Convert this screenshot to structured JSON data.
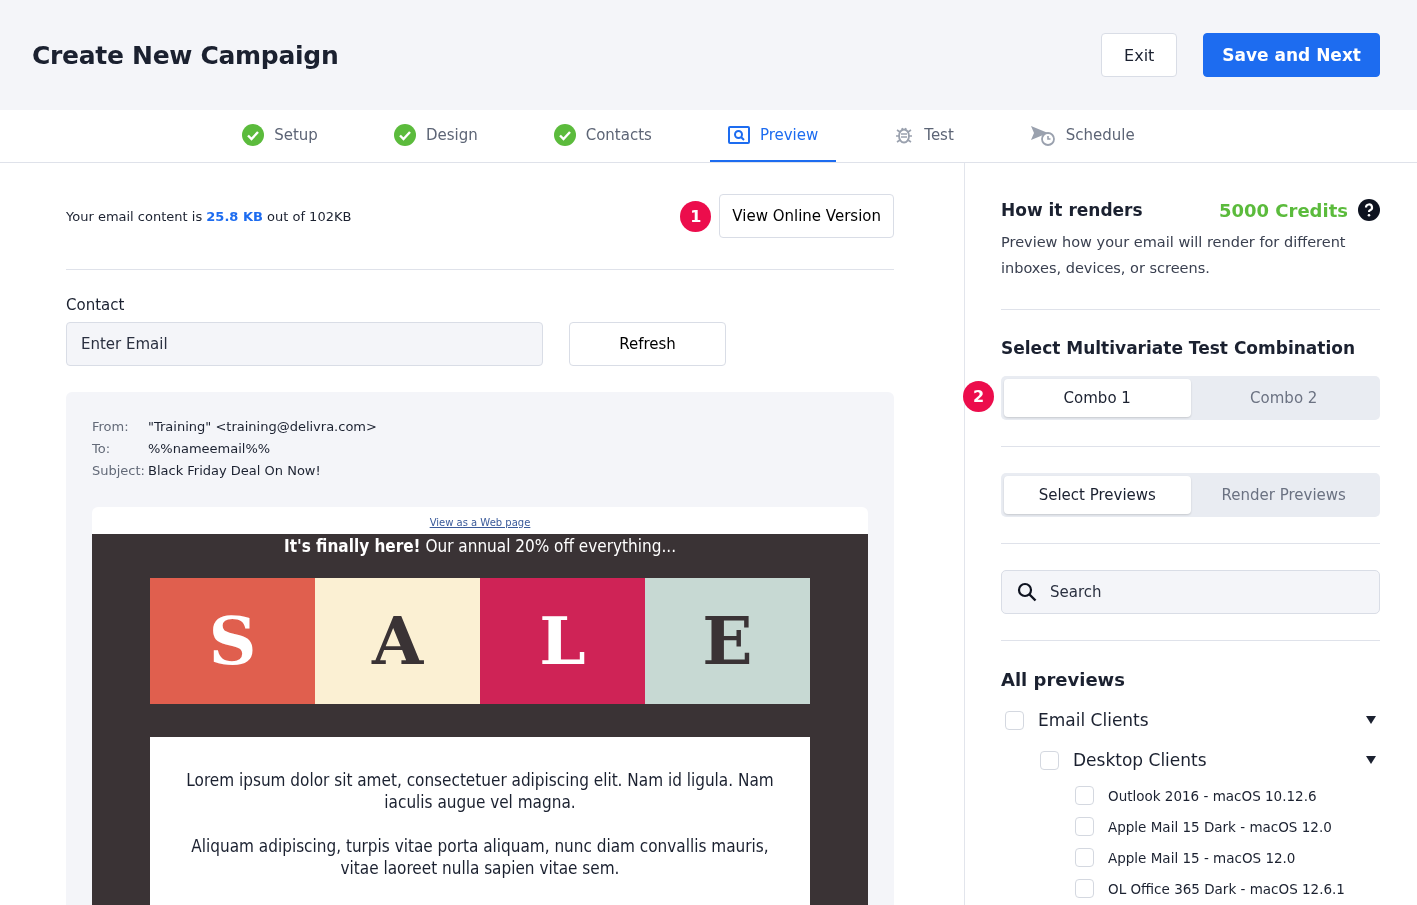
{
  "header": {
    "title": "Create New Campaign",
    "buttons": [
      {
        "label": "Exit",
        "kind": "secondary"
      },
      {
        "label": "Save and Next",
        "kind": "primary"
      }
    ]
  },
  "steps": [
    {
      "label": "Setup",
      "completed": true,
      "selected": false
    },
    {
      "label": "Design",
      "completed": true,
      "selected": false
    },
    {
      "label": "Contacts",
      "completed": true,
      "selected": false
    },
    {
      "label": "Preview",
      "completed": false,
      "selected": true
    },
    {
      "label": "Test",
      "completed": false,
      "selected": false
    },
    {
      "label": "Schedule",
      "completed": false,
      "selected": false
    }
  ],
  "size_note": "Your email content is **25.8 KB** out of 102KB",
  "marker_1": "1",
  "view_online": "View Online Version",
  "contact": {
    "label": "Contact",
    "placeholder": "Enter Email",
    "button": "Refresh"
  },
  "email": {
    "headers": [
      {
        "label": "From:",
        "value": "\"Training\" <training@delivra.com>"
      },
      {
        "label": "To:",
        "value": "%%nameemail%%"
      },
      {
        "label": "Subject:",
        "value": "Black Friday Deal On Now!"
      }
    ],
    "web_link": "View as a Web page",
    "banner": "**It's finally here!** Our annual 20% off everything...",
    "tiles": [
      {
        "letter": "S",
        "color": "#e05f4e"
      },
      {
        "letter": "A",
        "color": "#fbf0d3"
      },
      {
        "letter": "L",
        "color": "#cf2356"
      },
      {
        "letter": "E",
        "color": "#c7d9d3"
      }
    ],
    "paragraphs": [
      "Lorem ipsum dolor sit amet, consectetuer adipiscing elit. Nam id ligula. Nam iaculis augue vel magna.",
      "Aliquam adipiscing, turpis vitae porta aliquam, nunc diam convallis mauris, vitae laoreet nulla sapien vitae sem."
    ]
  },
  "panel": {
    "title": "How it renders",
    "credits": "5000 Credits",
    "description": "Preview how your email will render for different inboxes, devices, or screens.",
    "combo_title": "Select Multivariate Test Combination",
    "marker_2": "2",
    "combos": [
      {
        "label": "Combo 1",
        "selected": true
      },
      {
        "label": "Combo 2",
        "selected": false
      }
    ],
    "modes": [
      {
        "label": "Select Previews",
        "selected": true
      },
      {
        "label": "Render Previews",
        "selected": false
      }
    ],
    "search_placeholder": "Search",
    "list_title": "All previews",
    "tree": [
      {
        "label": "Email Clients",
        "checked": false,
        "expanded": true,
        "children": [
          {
            "label": "Desktop Clients",
            "checked": false,
            "expanded": true,
            "children": [
              {
                "label": "Outlook 2016 - macOS 10.12.6",
                "checked": false
              },
              {
                "label": "Apple Mail 15 Dark - macOS 12.0",
                "checked": false
              },
              {
                "label": "Apple Mail 15 - macOS 12.0",
                "checked": false
              },
              {
                "label": "OL Office 365 Dark - macOS 12.6.1",
                "checked": false
              }
            ]
          }
        ]
      }
    ]
  }
}
